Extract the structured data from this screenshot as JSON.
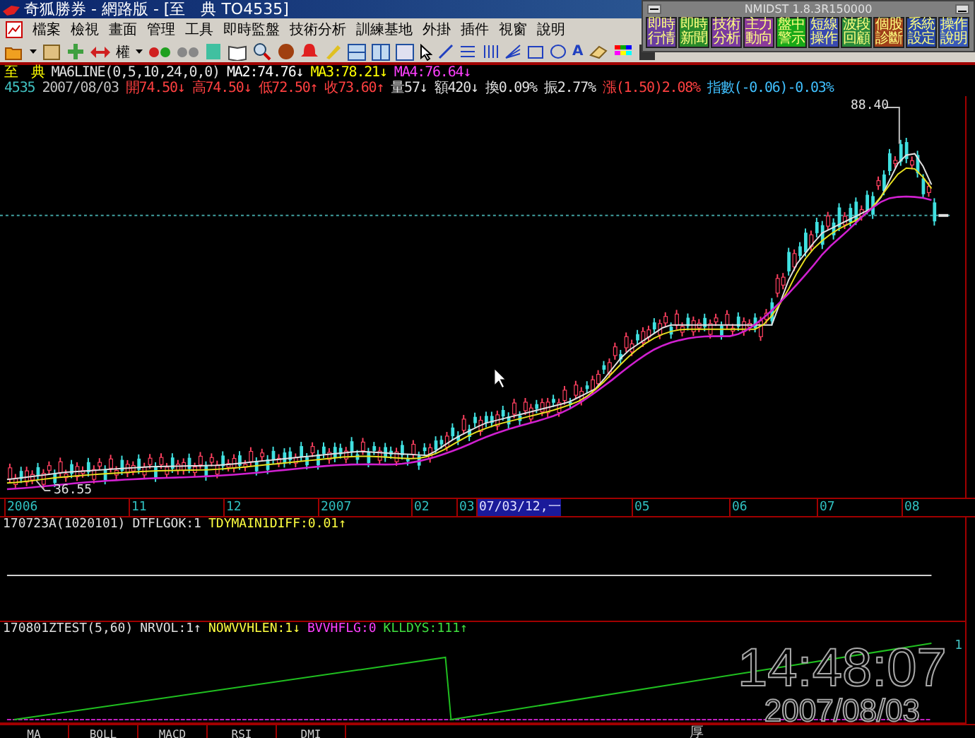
{
  "window": {
    "title": "奇狐勝券 - 網路版 - [至　典 TO4535]"
  },
  "menu": [
    "檔案",
    "檢視",
    "畫面",
    "管理",
    "工具",
    "即時監盤",
    "技術分析",
    "訓練基地",
    "外掛",
    "插件",
    "視窗",
    "說明"
  ],
  "toolbar": {
    "rights_label": "權",
    "text_tool_label": "A"
  },
  "widget": {
    "title": "NMIDST 1.8.3R150000",
    "tiles": [
      {
        "label": "即時行情",
        "color": "#6a3fa0"
      },
      {
        "label": "即時新聞",
        "color": "#2a8a2a"
      },
      {
        "label": "技術分析",
        "color": "#7a3aa0"
      },
      {
        "label": "主力動向",
        "color": "#8a3a9a"
      },
      {
        "label": "盤中警示",
        "color": "#18a818"
      },
      {
        "label": "短線操作",
        "color": "#3a4ab0"
      },
      {
        "label": "波段回顧",
        "color": "#2a8a3a"
      },
      {
        "label": "個股診斷",
        "color": "#a0401a"
      },
      {
        "label": "系統設定",
        "color": "#2a4aa8"
      },
      {
        "label": "操作說明",
        "color": "#3a5ab8"
      }
    ]
  },
  "info_line_1": [
    {
      "text": "至　典",
      "color": "#ffff00"
    },
    {
      "text": "MA6LINE(0,5,10,24,0,0)",
      "color": "#e0e0e0"
    },
    {
      "text": "MA2:74.76↓",
      "color": "#ffffff"
    },
    {
      "text": "MA3:78.21↓",
      "color": "#ffff00"
    },
    {
      "text": "MA4:76.64↓",
      "color": "#ff40ff"
    }
  ],
  "info_line_2": [
    {
      "text": "4535",
      "color": "#40c0c0"
    },
    {
      "text": "2007/08/03",
      "color": "#c0c0c0"
    },
    {
      "text": "開74.50↓",
      "color": "#ff4040"
    },
    {
      "text": "高74.50↓",
      "color": "#ff4040"
    },
    {
      "text": "低72.50↑",
      "color": "#ff4040"
    },
    {
      "text": "收73.60↑",
      "color": "#ff4040"
    },
    {
      "text": "量57↓",
      "color": "#e0e0e0"
    },
    {
      "text": "額420↓",
      "color": "#e0e0e0"
    },
    {
      "text": "換0.09%",
      "color": "#e0e0e0"
    },
    {
      "text": "振2.77%",
      "color": "#e0e0e0"
    },
    {
      "text": "漲(1.50)2.08%",
      "color": "#ff4040"
    },
    {
      "text": "指數(-0.06)-0.03%",
      "color": "#40c0ff"
    }
  ],
  "price_chart": {
    "high_label": "88.40",
    "low_label": "36.55"
  },
  "date_axis": [
    {
      "label": "2006",
      "selected": false
    },
    {
      "label": "11",
      "selected": false
    },
    {
      "label": "12",
      "selected": false
    },
    {
      "label": "2007",
      "selected": false
    },
    {
      "label": "02",
      "selected": false
    },
    {
      "label": "03",
      "selected": false
    },
    {
      "label": "07/03/12,一",
      "selected": true
    },
    {
      "label": "05",
      "selected": false
    },
    {
      "label": "06",
      "selected": false
    },
    {
      "label": "07",
      "selected": false
    },
    {
      "label": "08",
      "selected": false
    }
  ],
  "panel_1": {
    "legend": [
      {
        "text": "170723A(1020101)",
        "color": "#e0e0e0"
      },
      {
        "text": "DTFLGOK:1",
        "color": "#e0e0e0"
      },
      {
        "text": "TDYMAIN1DIFF:0.01↑",
        "color": "#ffff40"
      }
    ]
  },
  "panel_2": {
    "legend": [
      {
        "text": "170801ZTEST(5,60)",
        "color": "#e0e0e0"
      },
      {
        "text": "NRVOL:1↑",
        "color": "#e0e0e0"
      },
      {
        "text": "NOWVVHLEN:1↓",
        "color": "#ffff40"
      },
      {
        "text": "BVVHFLG:0",
        "color": "#ff40ff"
      },
      {
        "text": "KLLDYS:111↑",
        "color": "#40e040"
      }
    ],
    "scale_label": "1",
    "clock_time": "14:48:07",
    "clock_date": "2007/08/03"
  },
  "bottom_tabs": [
    "MA",
    "BOLL",
    "MACD",
    "RSI",
    "DMI"
  ],
  "status_char": "厚"
}
